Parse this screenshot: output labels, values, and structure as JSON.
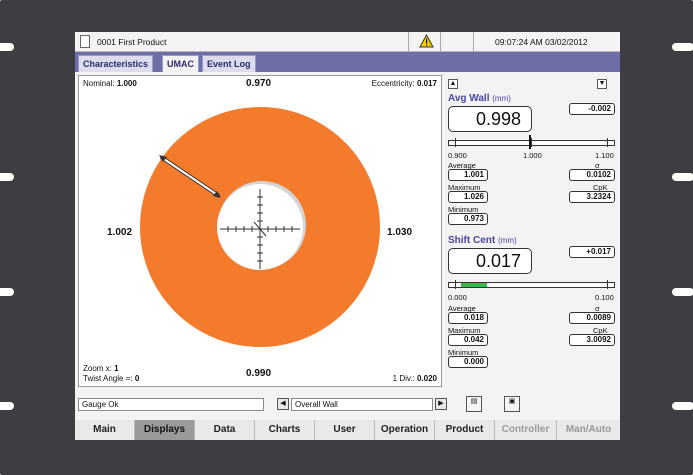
{
  "window": {
    "title": "0001 First Product",
    "datetime": "09:07:24 AM  03/02/2012"
  },
  "tabs": [
    {
      "label": "Characteristics"
    },
    {
      "label": "UMAC"
    },
    {
      "label": "Event Log"
    }
  ],
  "chart": {
    "nominal_label": "Nominal:",
    "nominal_value": "1.000",
    "eccentricity_label": "Eccentricity:",
    "eccentricity_value": "0.017",
    "top_value": "0.970",
    "left_value": "1.002",
    "right_value": "1.030",
    "bottom_value": "0.990",
    "zoom_label": "Zoom x:",
    "zoom_value": "1",
    "twist_label": "Twist Angle =:",
    "twist_value": "0",
    "div_label": "1 Div.:",
    "div_value": "0.020",
    "ring_color": "#f47a2c"
  },
  "avg_wall": {
    "title": "Avg Wall",
    "unit": "(mm)",
    "value": "0.998",
    "deviation": "-0.002",
    "scale": [
      "0.900",
      "1.000",
      "1.100"
    ],
    "scale_fraction": 0.49,
    "average_label": "Average",
    "average": "1.001",
    "sigma_label": "σ",
    "sigma": "0.0102",
    "maximum_label": "Maximum",
    "maximum": "1.026",
    "cpk_label": "CpK",
    "cpk": "3.2324",
    "minimum_label": "Minimum",
    "minimum": "0.973"
  },
  "shift_cent": {
    "title": "Shift Cent",
    "unit": "(mm)",
    "value": "0.017",
    "deviation": "+0.017",
    "scale": [
      "0.000",
      "0.100"
    ],
    "bar_fraction": 0.17,
    "bar_color": "#3cb54a",
    "average_label": "Average",
    "average": "0.018",
    "sigma_label": "σ",
    "sigma": "0.0089",
    "maximum_label": "Maximum",
    "maximum": "0.042",
    "cpk_label": "CpK",
    "cpk": "3.0092",
    "minimum_label": "Minimum",
    "minimum": "0.000"
  },
  "status": {
    "text": "Gauge Ok",
    "selection": "Overall Wall"
  },
  "nav": [
    {
      "label": "Main"
    },
    {
      "label": "Displays"
    },
    {
      "label": "Data"
    },
    {
      "label": "Charts"
    },
    {
      "label": "User"
    },
    {
      "label": "Operation"
    },
    {
      "label": "Product"
    },
    {
      "label": "Controller"
    },
    {
      "label": "Man/Auto"
    }
  ]
}
